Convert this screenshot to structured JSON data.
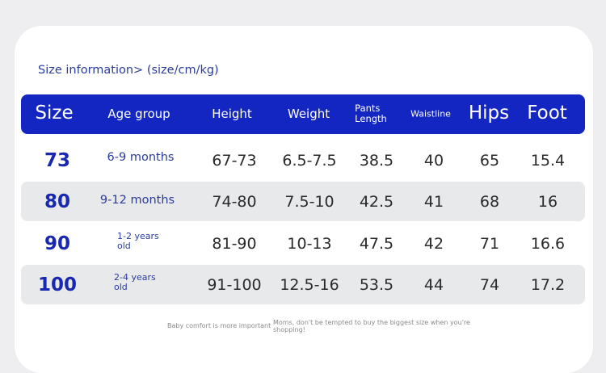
{
  "title": "Size information> (size/cm/kg)",
  "columns": {
    "size": "Size",
    "age": "Age group",
    "height": "Height",
    "weight": "Weight",
    "pants_line1": "Pants",
    "pants_line2": "Length",
    "waist": "Waistline",
    "hips": "Hips",
    "foot": "Foot"
  },
  "rows": [
    {
      "size": "73",
      "age": "6-9 months",
      "age_line1": "",
      "age_line2": "",
      "height": "67-73",
      "weight": "6.5-7.5",
      "pants": "38.5",
      "waist": "40",
      "hips": "65",
      "foot": "15.4"
    },
    {
      "size": "80",
      "age": "9-12 months",
      "age_line1": "",
      "age_line2": "",
      "height": "74-80",
      "weight": "7.5-10",
      "pants": "42.5",
      "waist": "41",
      "hips": "68",
      "foot": "16"
    },
    {
      "size": "90",
      "age": "",
      "age_line1": "1-2 years",
      "age_line2": "old",
      "height": "81-90",
      "weight": "10-13",
      "pants": "47.5",
      "waist": "42",
      "hips": "71",
      "foot": "16.6"
    },
    {
      "size": "100",
      "age": "",
      "age_line1": "2-4 years",
      "age_line2": "old",
      "height": "91-100",
      "weight": "12.5-16",
      "pants": "53.5",
      "waist": "44",
      "hips": "74",
      "foot": "17.2"
    }
  ],
  "footer": {
    "left_note": "Baby comfort is more important",
    "right_note_line1": "Moms, don't be tempted to buy the biggest size when you're",
    "right_note_line2": "shopping!"
  }
}
